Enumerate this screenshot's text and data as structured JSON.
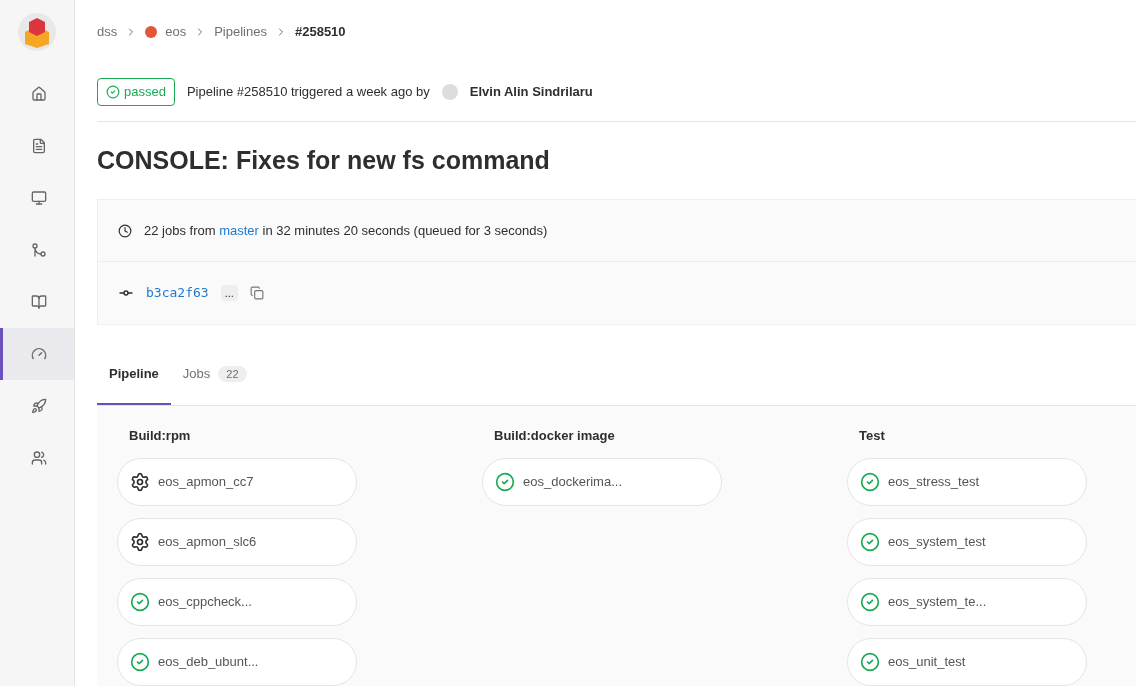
{
  "sidebar": {
    "items": [
      {
        "selected": false
      },
      {
        "selected": false
      },
      {
        "selected": false
      },
      {
        "selected": false
      },
      {
        "selected": false
      },
      {
        "selected": true
      },
      {
        "selected": false
      },
      {
        "selected": false
      }
    ]
  },
  "breadcrumb": [
    {
      "label": "dss",
      "kind": "text"
    },
    {
      "label": "eos",
      "kind": "project"
    },
    {
      "label": "Pipelines",
      "kind": "text"
    },
    {
      "label": "#258510",
      "kind": "current"
    }
  ],
  "header": {
    "status": "passed",
    "summary": "Pipeline #258510 triggered a week ago by",
    "user": "Elvin Alin Sindrilaru"
  },
  "title": "CONSOLE: Fixes for new fs command",
  "info": {
    "jobs_text": "22 jobs from",
    "branch": "master",
    "duration_text": "in 32 minutes 20 seconds (queued for 3 seconds)",
    "commit": "b3ca2f63",
    "ellipsis": "..."
  },
  "tabs": [
    {
      "label": "Pipeline",
      "selected": true
    },
    {
      "label": "Jobs",
      "count": "22",
      "selected": false
    }
  ],
  "stages": [
    {
      "name": "Build:rpm",
      "jobs": [
        {
          "name": "eos_apmon_cc7",
          "kind": "manual"
        },
        {
          "name": "eos_apmon_slc6",
          "kind": "manual"
        },
        {
          "name": "eos_cppcheck...",
          "kind": "success"
        },
        {
          "name": "eos_deb_ubunt...",
          "kind": "success"
        }
      ]
    },
    {
      "name": "Build:docker image",
      "jobs": [
        {
          "name": "eos_dockerima...",
          "kind": "success"
        }
      ]
    },
    {
      "name": "Test",
      "jobs": [
        {
          "name": "eos_stress_test",
          "kind": "success"
        },
        {
          "name": "eos_system_test",
          "kind": "success"
        },
        {
          "name": "eos_system_te...",
          "kind": "success"
        },
        {
          "name": "eos_unit_test",
          "kind": "success"
        }
      ]
    }
  ]
}
